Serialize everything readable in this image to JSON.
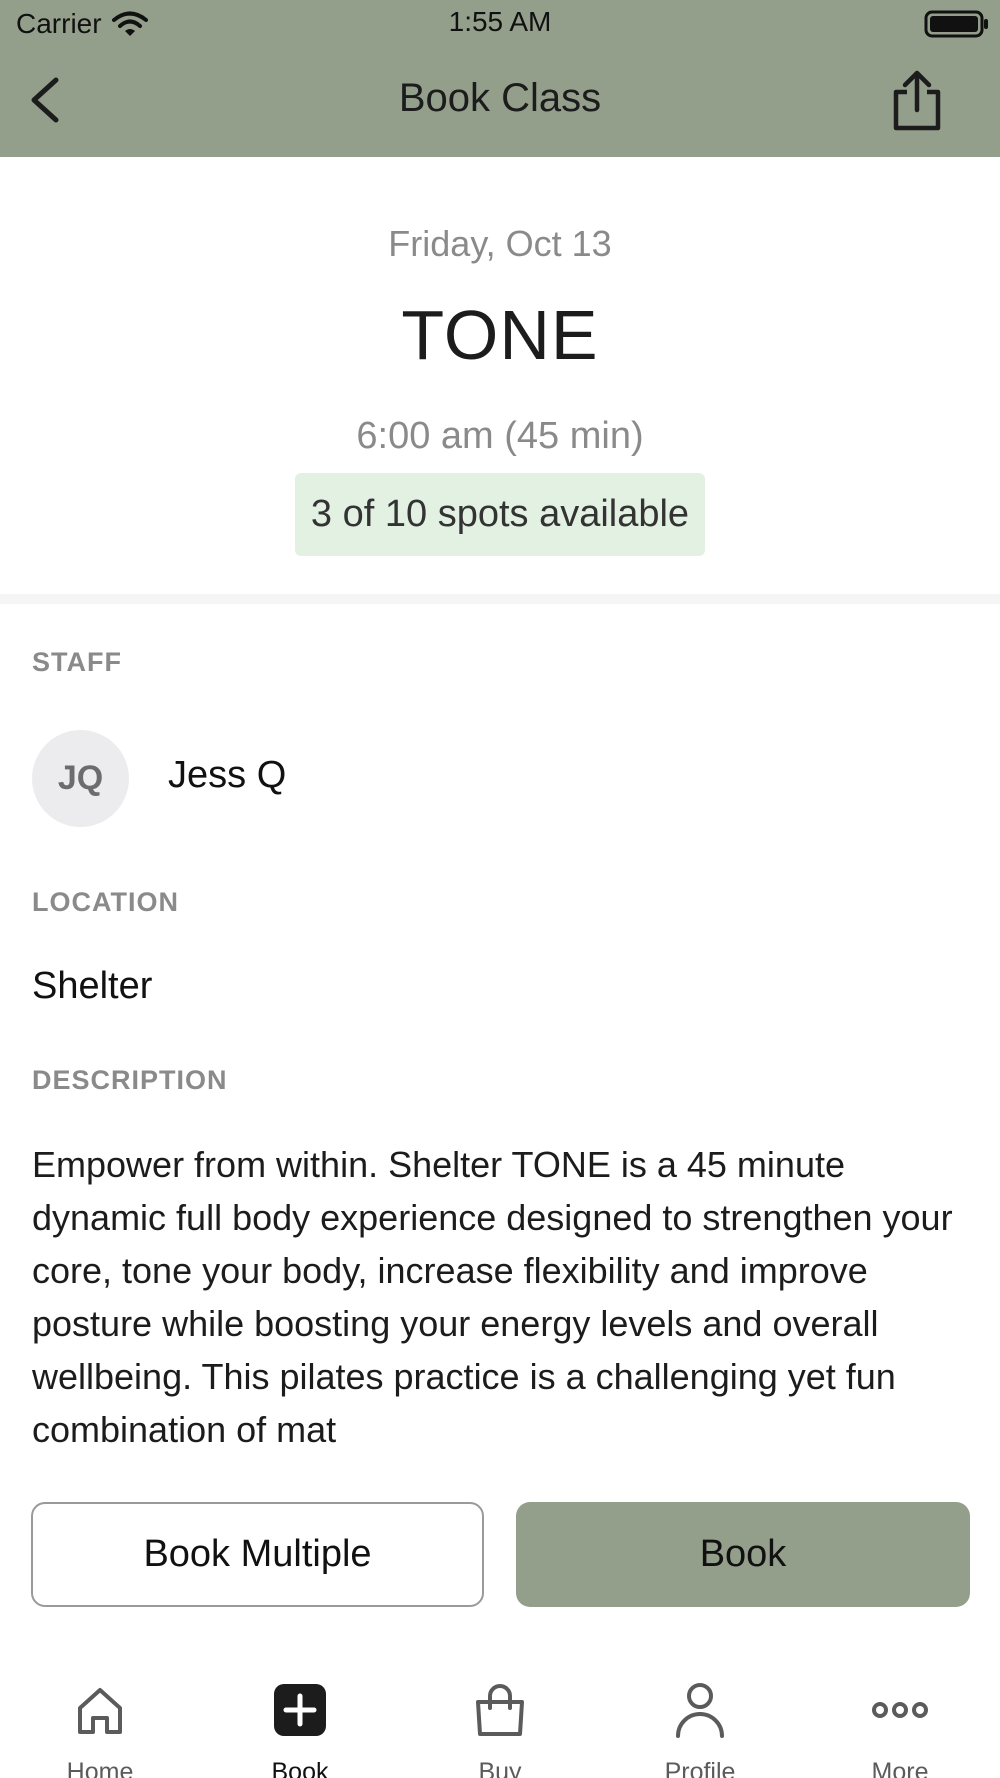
{
  "status_bar": {
    "carrier": "Carrier",
    "time": "1:55 AM"
  },
  "nav": {
    "title": "Book Class"
  },
  "class": {
    "date": "Friday, Oct 13",
    "name": "TONE",
    "time": "6:00 am (45 min)",
    "spots": "3 of 10 spots available"
  },
  "staff": {
    "label": "STAFF",
    "initials": "JQ",
    "name": "Jess Q"
  },
  "location": {
    "label": "LOCATION",
    "name": "Shelter"
  },
  "description": {
    "label": "DESCRIPTION",
    "text": "Empower from within. Shelter TONE is a 45 minute dynamic full body experience designed to strengthen your core, tone your body, increase flexibility and improve posture while boosting your energy levels and overall wellbeing. This pilates practice is a challenging yet fun combination of mat"
  },
  "buttons": {
    "book_multiple": "Book Multiple",
    "book": "Book"
  },
  "tabs": [
    {
      "label": "Home",
      "icon": "home-icon"
    },
    {
      "label": "Book",
      "icon": "plus-square-icon"
    },
    {
      "label": "Buy",
      "icon": "shopping-bag-icon"
    },
    {
      "label": "Profile",
      "icon": "person-icon"
    },
    {
      "label": "More",
      "icon": "more-dots-icon"
    }
  ],
  "colors": {
    "header": "#939f8b",
    "book_button": "#939f8b",
    "spots_badge": "#e3f1e3",
    "muted_text": "#8a8a8a"
  }
}
